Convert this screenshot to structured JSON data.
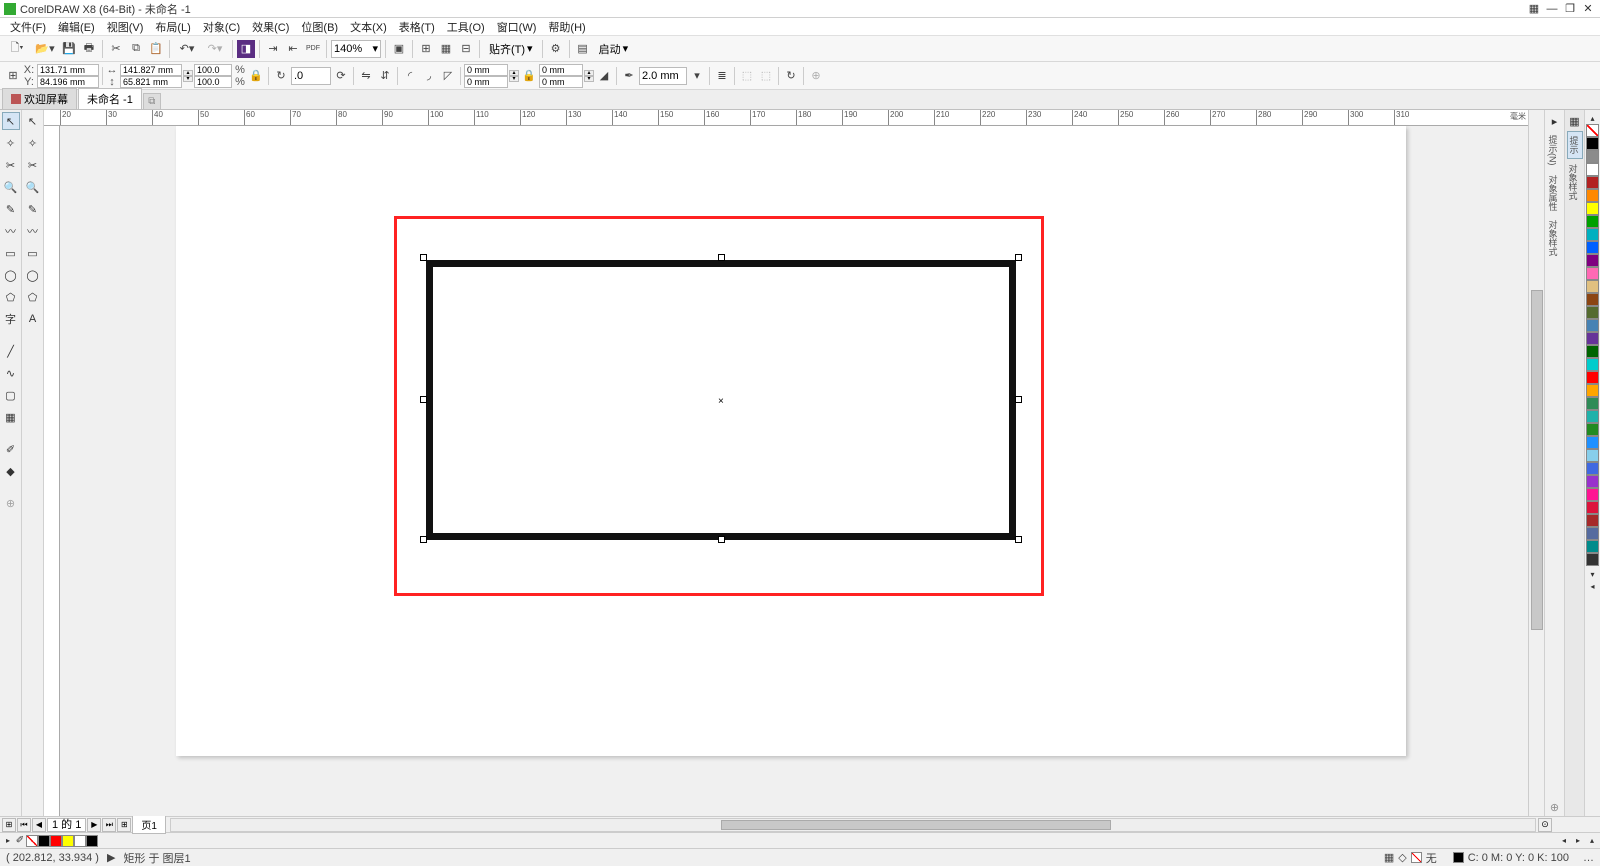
{
  "title": "CorelDRAW X8 (64-Bit) - 未命名 -1",
  "menus": [
    "文件(F)",
    "编辑(E)",
    "视图(V)",
    "布局(L)",
    "对象(C)",
    "效果(C)",
    "位图(B)",
    "文本(X)",
    "表格(T)",
    "工具(O)",
    "窗口(W)",
    "帮助(H)"
  ],
  "toolbar": {
    "zoom": "140%",
    "snap_label": "贴齐(T)",
    "launch_label": "启动"
  },
  "propbar": {
    "x_label": "X:",
    "x": "131.71 mm",
    "y_label": "Y:",
    "y": "84.196 mm",
    "w": "141.827 mm",
    "h": "65.821 mm",
    "sx": "100.0",
    "sy": "100.0",
    "pct": "%",
    "rot": ".0",
    "corner_a": "0 mm",
    "corner_b": "0 mm",
    "corner_c": "0 mm",
    "corner_d": "0 mm",
    "outline": "2.0 mm"
  },
  "tabs": {
    "welcome": "欢迎屏幕",
    "doc": "未命名 -1"
  },
  "ruler_h": [
    "20",
    "30",
    "40",
    "50",
    "60",
    "70",
    "80",
    "90",
    "100",
    "110",
    "120",
    "130",
    "140",
    "150",
    "160",
    "170",
    "180",
    "190",
    "200",
    "210",
    "220",
    "230",
    "240",
    "250",
    "260",
    "270",
    "280",
    "290",
    "300",
    "310"
  ],
  "pagebar": {
    "count": "1 的 1",
    "page": "页1"
  },
  "docpalette": [
    "#000000",
    "#ff0000",
    "#ffff00",
    "#ffffff",
    "#000000"
  ],
  "palette": [
    "#000000",
    "#8b8b8b",
    "#ffffff",
    "#b22222",
    "#ff8800",
    "#ffff00",
    "#00a000",
    "#00b0c0",
    "#0060ff",
    "#800080",
    "#ff69b4",
    "#e0c080",
    "#8b4513",
    "#556b2f",
    "#4682b4",
    "#663399",
    "#006400",
    "#00cccc",
    "#ff0000",
    "#ffa500",
    "#2e8b57",
    "#20b2aa",
    "#228b22",
    "#1e90ff",
    "#87ceeb",
    "#4169e1",
    "#9932cc",
    "#ff1493",
    "#dc143c",
    "#a52a2a",
    "#556b9f",
    "#008b8b",
    "#333333"
  ],
  "dockers": [
    "提示(N)",
    "对象属性",
    "对象样式"
  ],
  "dockers2": [
    "提示",
    "对象样式"
  ],
  "status": {
    "coords": "( 202.812, 33.934 )",
    "arrow": "▶",
    "object": "矩形 于 图层1",
    "fill_label": "无",
    "color_readout": "C: 0 M: 0 Y: 0 K: 100"
  },
  "ruler_unit": "毫米"
}
